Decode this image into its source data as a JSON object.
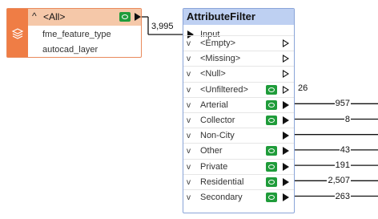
{
  "source_node": {
    "header_label": "<All>",
    "attributes": [
      "fme_feature_type",
      "autocad_layer"
    ],
    "accent_color": "#ef7d45"
  },
  "transformer": {
    "title": "AttributeFilter",
    "input_label": "Input",
    "ports": [
      {
        "label": "<Empty>",
        "eye": false,
        "open": true,
        "count": ""
      },
      {
        "label": "<Missing>",
        "eye": false,
        "open": true,
        "count": ""
      },
      {
        "label": "<Null>",
        "eye": false,
        "open": true,
        "count": ""
      },
      {
        "label": "<Unfiltered>",
        "eye": true,
        "open": true,
        "count": "26"
      },
      {
        "label": "Arterial",
        "eye": true,
        "open": false,
        "count": "957"
      },
      {
        "label": "Collector",
        "eye": true,
        "open": false,
        "count": "8"
      },
      {
        "label": "Non-City",
        "eye": false,
        "open": false,
        "count": ""
      },
      {
        "label": "Other",
        "eye": true,
        "open": false,
        "count": "43"
      },
      {
        "label": "Private",
        "eye": true,
        "open": false,
        "count": "191"
      },
      {
        "label": "Residential",
        "eye": true,
        "open": false,
        "count": "2,507"
      },
      {
        "label": "Secondary",
        "eye": true,
        "open": false,
        "count": "263"
      }
    ]
  },
  "connection": {
    "count": "3,995"
  }
}
